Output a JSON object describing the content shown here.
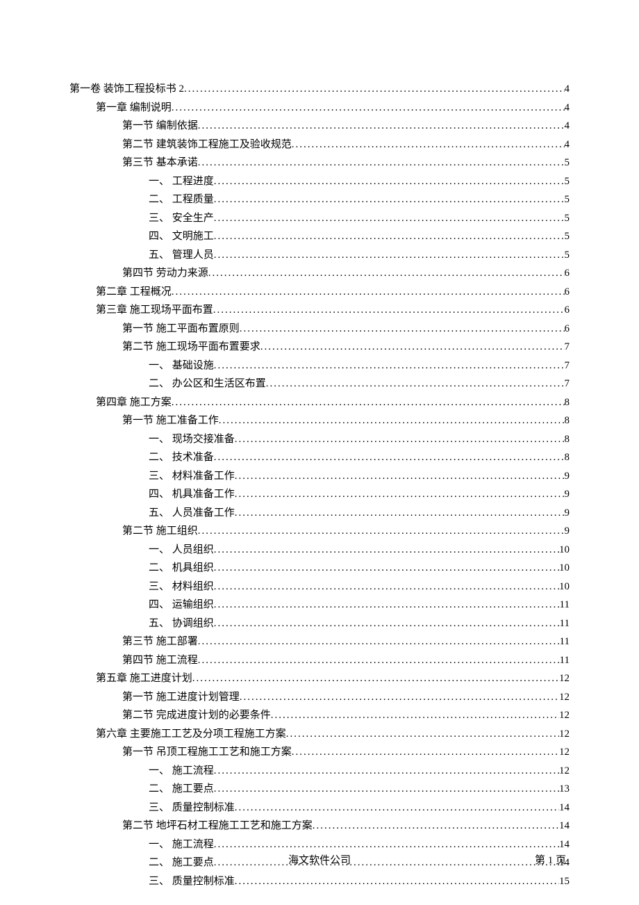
{
  "toc": [
    {
      "indent": 0,
      "label": "第一卷  装饰工程投标书 2",
      "page": "4"
    },
    {
      "indent": 1,
      "label": "第一章  编制说明",
      "page": "4"
    },
    {
      "indent": 2,
      "label": "第一节  编制依据",
      "page": "4"
    },
    {
      "indent": 2,
      "label": "第二节  建筑装饰工程施工及验收规范",
      "page": "4"
    },
    {
      "indent": 2,
      "label": "第三节  基本承诺",
      "page": "5"
    },
    {
      "indent": 3,
      "label": "一、  工程进度",
      "page": "5"
    },
    {
      "indent": 3,
      "label": "二、  工程质量",
      "page": "5"
    },
    {
      "indent": 3,
      "label": "三、  安全生产",
      "page": "5"
    },
    {
      "indent": 3,
      "label": "四、  文明施工",
      "page": "5"
    },
    {
      "indent": 3,
      "label": "五、  管理人员",
      "page": "5"
    },
    {
      "indent": 2,
      "label": "第四节  劳动力来源",
      "page": "6"
    },
    {
      "indent": 1,
      "label": "第二章  工程概况",
      "page": "6"
    },
    {
      "indent": 1,
      "label": "第三章  施工现场平面布置",
      "page": "6"
    },
    {
      "indent": 2,
      "label": "第一节  施工平面布置原则",
      "page": "6"
    },
    {
      "indent": 2,
      "label": "第二节  施工现场平面布置要求",
      "page": "7"
    },
    {
      "indent": 3,
      "label": "一、  基础设施",
      "page": "7"
    },
    {
      "indent": 3,
      "label": "二、  办公区和生活区布置",
      "page": "7"
    },
    {
      "indent": 1,
      "label": "第四章  施工方案",
      "page": "8"
    },
    {
      "indent": 2,
      "label": "第一节  施工准备工作",
      "page": "8"
    },
    {
      "indent": 3,
      "label": "一、  现场交接准备",
      "page": "8"
    },
    {
      "indent": 3,
      "label": "二、  技术准备",
      "page": "8"
    },
    {
      "indent": 3,
      "label": "三、  材料准备工作",
      "page": "9"
    },
    {
      "indent": 3,
      "label": "四、  机具准备工作",
      "page": "9"
    },
    {
      "indent": 3,
      "label": "五、  人员准备工作",
      "page": "9"
    },
    {
      "indent": 2,
      "label": "第二节  施工组织",
      "page": "9"
    },
    {
      "indent": 3,
      "label": "一、  人员组织",
      "page": "10"
    },
    {
      "indent": 3,
      "label": "二、  机具组织",
      "page": "10"
    },
    {
      "indent": 3,
      "label": "三、  材料组织",
      "page": "10"
    },
    {
      "indent": 3,
      "label": "四、  运输组织",
      "page": "11"
    },
    {
      "indent": 3,
      "label": "五、  协调组织",
      "page": "11"
    },
    {
      "indent": 2,
      "label": "第三节  施工部署",
      "page": "11"
    },
    {
      "indent": 2,
      "label": "第四节  施工流程",
      "page": "11"
    },
    {
      "indent": 1,
      "label": "第五章  施工进度计划",
      "page": "12"
    },
    {
      "indent": 2,
      "label": "第一节  施工进度计划管理",
      "page": "12"
    },
    {
      "indent": 2,
      "label": "第二节  完成进度计划的必要条件",
      "page": "12"
    },
    {
      "indent": 1,
      "label": "第六章  主要施工工艺及分项工程施工方案",
      "page": "12"
    },
    {
      "indent": 2,
      "label": "第一节  吊顶工程施工工艺和施工方案",
      "page": "12"
    },
    {
      "indent": 3,
      "label": "一、  施工流程",
      "page": "12"
    },
    {
      "indent": 3,
      "label": "二、  施工要点",
      "page": "13"
    },
    {
      "indent": 3,
      "label": "三、  质量控制标准",
      "page": "14"
    },
    {
      "indent": 2,
      "label": "第二节  地坪石材工程施工工艺和施工方案",
      "page": "14"
    },
    {
      "indent": 3,
      "label": "一、  施工流程",
      "page": "14"
    },
    {
      "indent": 3,
      "label": "二、  施工要点",
      "page": "14"
    },
    {
      "indent": 3,
      "label": "三、  质量控制标准",
      "page": "15"
    }
  ],
  "footer": {
    "company": "海文软件公司",
    "page_label": "第 1 页"
  }
}
